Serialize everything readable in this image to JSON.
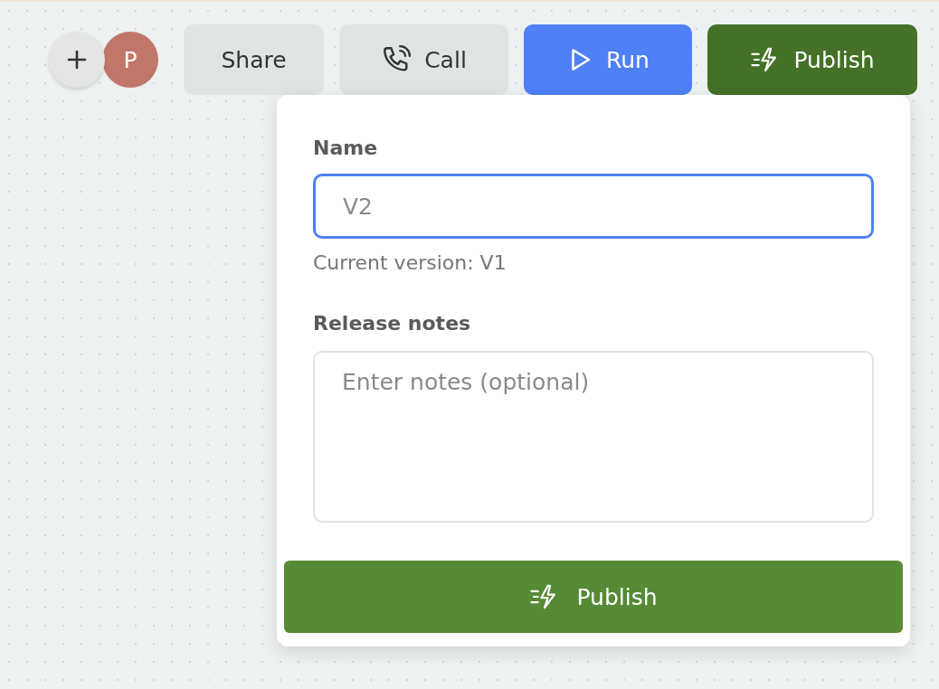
{
  "toolbar": {
    "avatar": {
      "initial": "P",
      "color": "#c0776a"
    },
    "buttons": [
      {
        "label": "Share",
        "kind": "plain"
      },
      {
        "label": "Call",
        "kind": "call"
      },
      {
        "label": "Run",
        "kind": "run"
      },
      {
        "label": "Publish",
        "kind": "publish"
      }
    ]
  },
  "popover": {
    "name_label": "Name",
    "name_field": {
      "placeholder": "V2",
      "focused": true
    },
    "helper": "Current version: V1",
    "notes_label": "Release notes",
    "notes_field": {
      "placeholder": "Enter notes (optional)",
      "focused": false
    },
    "submit": "Publish"
  }
}
